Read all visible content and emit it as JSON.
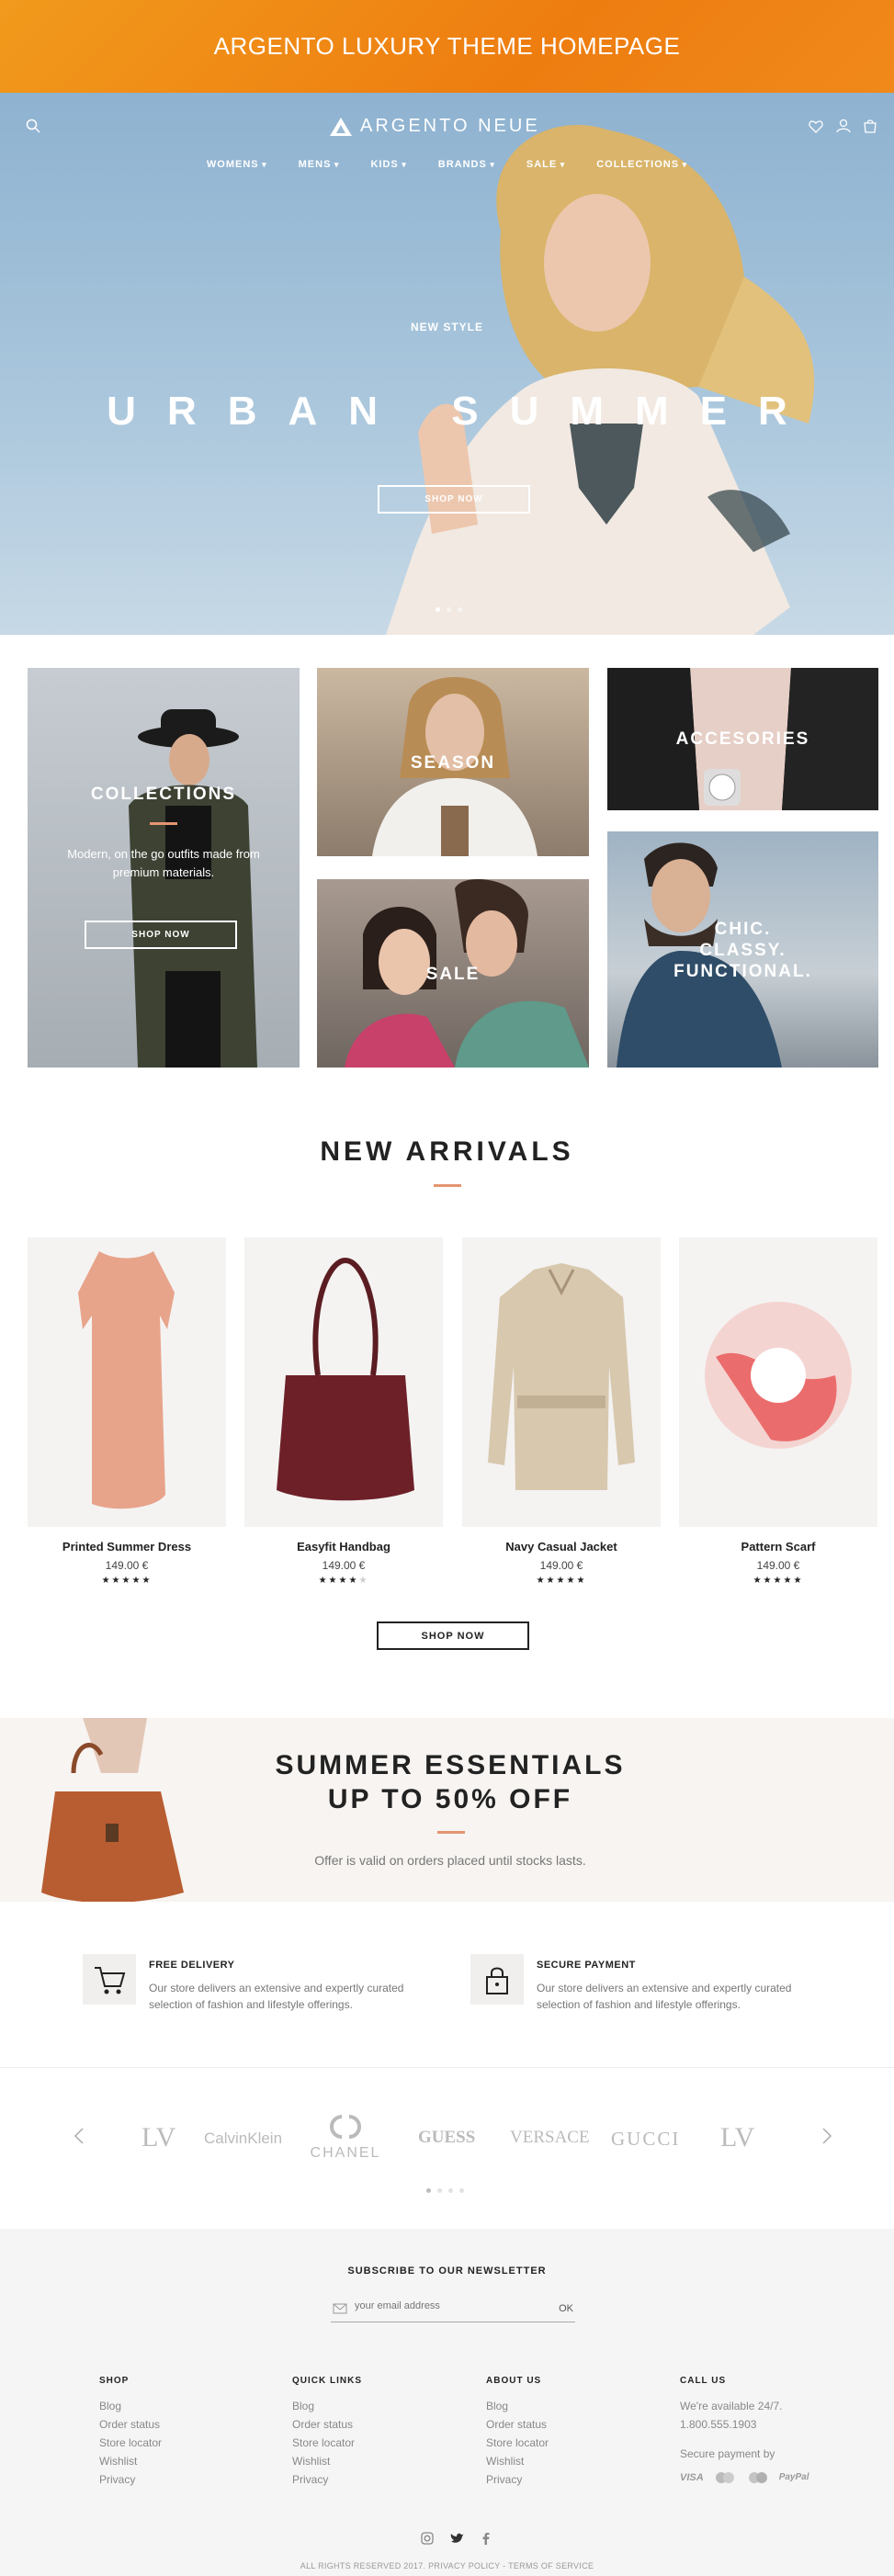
{
  "banner": {
    "title": "ARGENTO LUXURY THEME HOMEPAGE"
  },
  "header": {
    "logo": "ARGENTO NEUE",
    "icons": [
      "search-icon",
      "heart-icon",
      "user-icon",
      "cart-icon"
    ]
  },
  "nav": [
    "WOMENS",
    "MENS",
    "KIDS",
    "BRANDS",
    "SALE",
    "COLLECTIONS"
  ],
  "hero": {
    "eyebrow": "NEW STYLE",
    "title": "URBAN SUMMER",
    "button": "SHOP NOW"
  },
  "tiles": {
    "collections": {
      "label": "COLLECTIONS",
      "text": "Modern, on the go outfits made from premium materials.",
      "button": "SHOP NOW"
    },
    "season": "SEASON",
    "accessories": "ACCESORIES",
    "sale": "SALE",
    "chic": [
      "CHIC.",
      "CLASSY.",
      "FUNCTIONAL."
    ]
  },
  "new_arrivals": {
    "title": "NEW ARRIVALS",
    "button": "SHOP NOW",
    "products": [
      {
        "name": "Printed Summer Dress",
        "price": "149.00 €",
        "rating": 5
      },
      {
        "name": "Easyfit Handbag",
        "price": "149.00 €",
        "rating": 4
      },
      {
        "name": "Navy Casual Jacket",
        "price": "149.00 €",
        "rating": 5
      },
      {
        "name": "Pattern Scarf",
        "price": "149.00 €",
        "rating": 5
      }
    ]
  },
  "promo": {
    "line1": "SUMMER ESSENTIALS",
    "line2": "UP TO 50% OFF",
    "text": "Offer is valid on orders placed until stocks lasts."
  },
  "features": [
    {
      "title": "FREE DELIVERY",
      "text": "Our store delivers an extensive and expertly curated selection of fashion and lifestyle offerings.",
      "icon": "cart-icon"
    },
    {
      "title": "SECURE PAYMENT",
      "text": "Our store delivers an extensive and expertly curated selection of fashion and lifestyle offerings.",
      "icon": "lock-icon"
    }
  ],
  "brands": [
    "CalvinKlein",
    "CHANEL",
    "GUESS",
    "VERSACE",
    "GUCCI"
  ],
  "newsletter": {
    "title": "SUBSCRIBE TO OUR NEWSLETTER",
    "placeholder": "your email address",
    "button": "OK"
  },
  "footer": {
    "columns": [
      {
        "title": "SHOP",
        "links": [
          "Blog",
          "Order status",
          "Store locator",
          "Wishlist",
          "Privacy"
        ]
      },
      {
        "title": "QUICK LINKS",
        "links": [
          "Blog",
          "Order status",
          "Store locator",
          "Wishlist",
          "Privacy"
        ]
      },
      {
        "title": "ABOUT US",
        "links": [
          "Blog",
          "Order status",
          "Store locator",
          "Wishlist",
          "Privacy"
        ]
      }
    ],
    "call": {
      "title": "CALL US",
      "line1": "We're available 24/7.",
      "phone": "1.800.555.1903",
      "secure": "Secure payment by",
      "cards": [
        "VISA",
        "PayPal"
      ]
    },
    "copyright": "ALL RIGHTS RESERVED 2017. PRIVACY POLICY - TERMS OF SERVICE"
  },
  "colors": {
    "banner": "#f08a15",
    "accent": "#e59572",
    "footer_bg": "#f5f5f5"
  }
}
